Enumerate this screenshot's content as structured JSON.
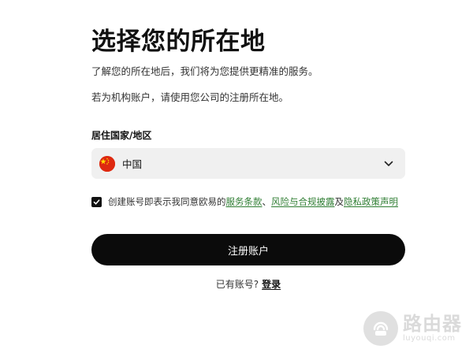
{
  "header": {
    "title": "选择您的所在地",
    "subtitle": "了解您的所在地后，我们将为您提供更精准的服务。",
    "subtitle_org": "若为机构账户，请使用您公司的注册所在地。"
  },
  "form": {
    "country_label": "居住国家/地区",
    "country_value": "中国",
    "country_flag_icon": "china-flag-icon",
    "consent": {
      "checked": true,
      "prefix": "创建账号即表示我同意欧易的",
      "terms_link": "服务条款",
      "separator": "、",
      "risk_link": "风险与合规披露",
      "conjunction": "及",
      "privacy_link": "隐私政策声明"
    },
    "submit_label": "注册账户"
  },
  "footer": {
    "have_account": "已有账号?",
    "login_label": "登录"
  },
  "watermark": {
    "main": "路由器",
    "sub": "luyouqi.com"
  },
  "colors": {
    "primary_button": "#0b0b0b",
    "link": "#2e7d32",
    "select_bg": "#f0f0f0",
    "flag_red": "#de2910",
    "flag_star": "#ffde00"
  }
}
